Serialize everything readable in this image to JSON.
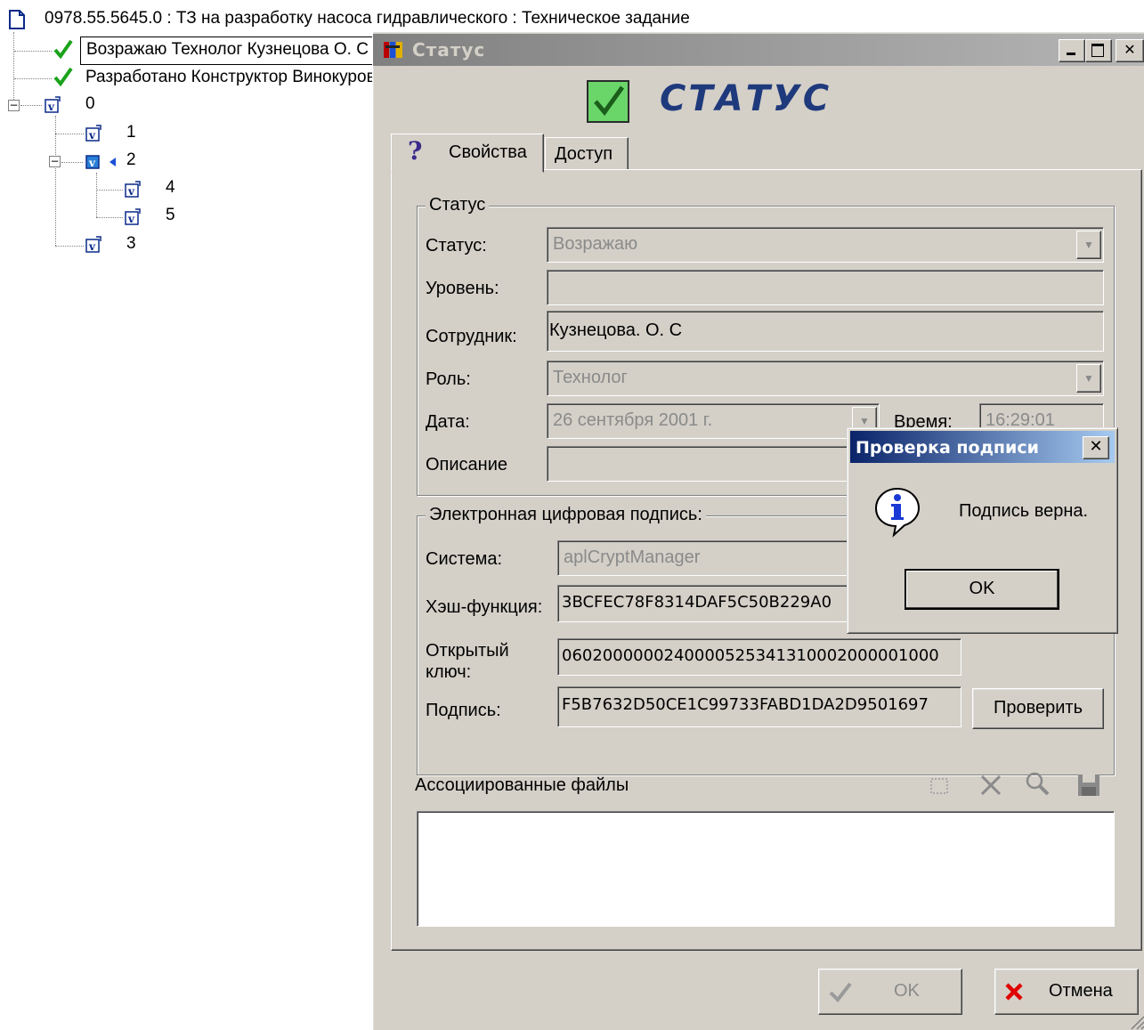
{
  "tree": {
    "root_label": "0978.55.5645.0 : ТЗ на разработку насоса гидравлического : Техническое задание",
    "status_items": [
      {
        "label": "Возражаю Технолог Кузнецова О. С"
      },
      {
        "label": "Разработано Конструктор Винокуров"
      }
    ],
    "versions": [
      "0",
      "1",
      "2",
      "4",
      "5",
      "3"
    ]
  },
  "dialog": {
    "title": "Статус",
    "header_title": "СТАТУС",
    "tabs": [
      "Свойства",
      "Доступ"
    ],
    "help_glyph": "?",
    "status_group": {
      "legend": "Статус",
      "status_label": "Статус:",
      "status_value": "Возражаю",
      "level_label": "Уровень:",
      "level_value": "",
      "employee_label": "Сотрудник:",
      "employee_value": "Кузнецова. О. С",
      "role_label": "Роль:",
      "role_value": "Технолог",
      "date_label": "Дата:",
      "date_value": "26 сентября 2001 г.",
      "time_label": "Время:",
      "time_value": "16:29:01",
      "description_label": "Описание",
      "description_value": ""
    },
    "signature_group": {
      "legend": "Электронная цифровая подпись:",
      "system_label": "Система:",
      "system_value": "aplCryptManager",
      "hash_label": "Хэш-функция:",
      "hash_value": "3BCFEC78F8314DAF5C50B229A0",
      "public_key_label_1": "Открытый",
      "public_key_label_2": "ключ:",
      "public_key_value": "0602000000240000525341310002000001000",
      "signature_label": "Подпись:",
      "signature_value": "F5B7632D50CE1C99733FABD1DA2D9501697",
      "verify_button": "Проверить"
    },
    "files": {
      "label": "Ассоциированные файлы"
    },
    "ok_button": "OK",
    "cancel_button": "Отмена"
  },
  "message_box": {
    "title": "Проверка подписи",
    "text": "Подпись верна.",
    "ok_button": "OK",
    "close_glyph": "✕"
  },
  "colors": {
    "check_green": "#1aa31a",
    "header_blue": "#1f3a7c",
    "msg_title_blue": "#0a246a",
    "cancel_red": "#e00000"
  }
}
